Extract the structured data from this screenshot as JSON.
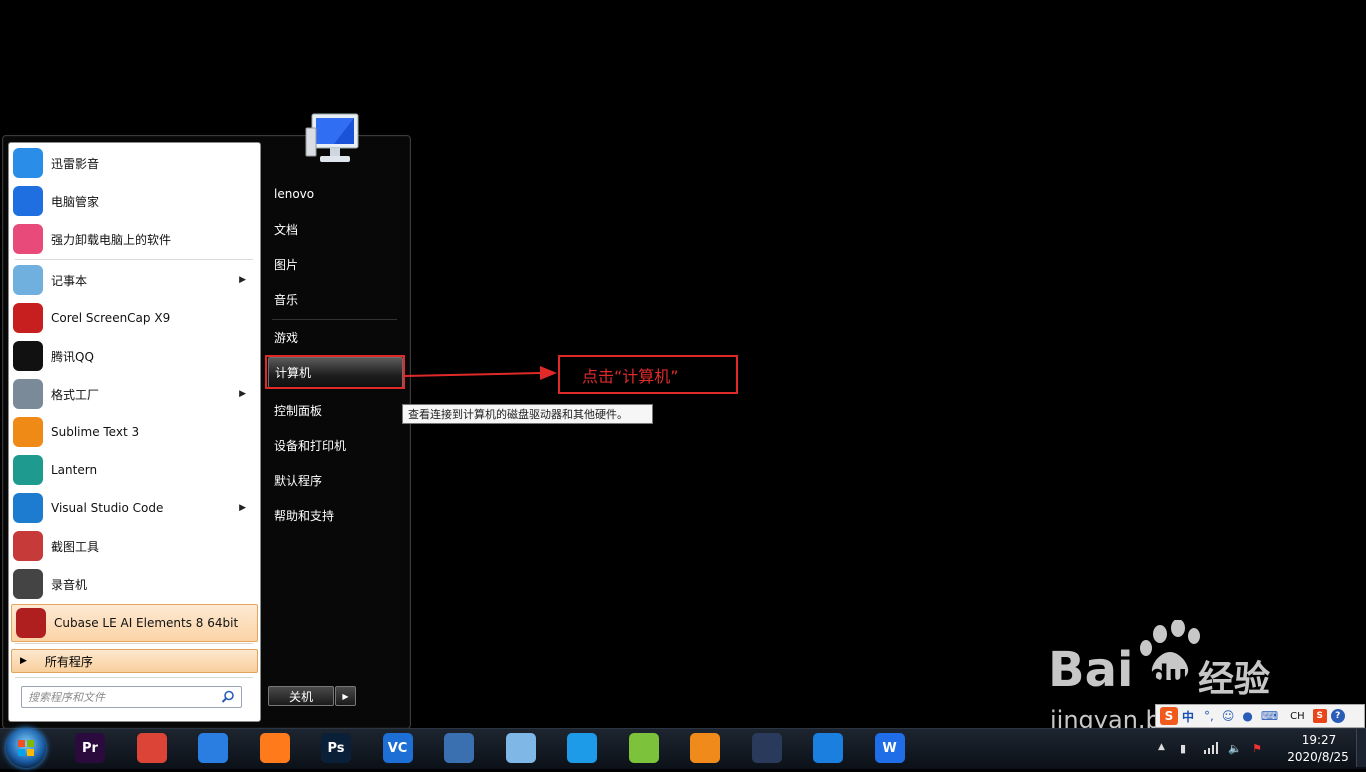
{
  "pinned": [
    {
      "label": "迅雷影音",
      "icon": "xunlei-player-icon",
      "color": "#2a8de8"
    },
    {
      "label": "电脑管家",
      "icon": "pc-manager-shield-icon",
      "color": "#1f6fe0"
    },
    {
      "label": "强力卸载电脑上的软件",
      "icon": "uninstaller-flower-icon",
      "color": "#e84a7a"
    }
  ],
  "recent": [
    {
      "label": "记事本",
      "icon": "notepad-icon",
      "color": "#6fb0df",
      "has_submenu": true
    },
    {
      "label": "Corel ScreenCap X9",
      "icon": "corel-screencap-icon",
      "color": "#c71f1f",
      "has_submenu": false
    },
    {
      "label": "腾讯QQ",
      "icon": "qq-penguin-icon",
      "color": "#111111",
      "has_submenu": false
    },
    {
      "label": "格式工厂",
      "icon": "format-factory-icon",
      "color": "#7a8a99",
      "has_submenu": true
    },
    {
      "label": "Sublime Text 3",
      "icon": "sublime-text-icon",
      "color": "#ef8a16",
      "has_submenu": false
    },
    {
      "label": "Lantern",
      "icon": "lantern-icon",
      "color": "#1f9a8f",
      "has_submenu": false
    },
    {
      "label": "Visual Studio Code",
      "icon": "vscode-icon",
      "color": "#1e7cd0",
      "has_submenu": true
    },
    {
      "label": "截图工具",
      "icon": "snipping-tool-scissors-icon",
      "color": "#c63a3a",
      "has_submenu": false
    },
    {
      "label": "录音机",
      "icon": "sound-recorder-mic-icon",
      "color": "#444444",
      "has_submenu": false
    },
    {
      "label": "Cubase LE AI Elements 8 64bit",
      "icon": "cubase-icon",
      "color": "#b01f1f",
      "has_submenu": false
    }
  ],
  "all_programs_label": "所有程序",
  "search_placeholder": "搜索程序和文件",
  "right_pane": {
    "user": "lenovo",
    "documents": "文档",
    "pictures": "图片",
    "music": "音乐",
    "games": "游戏",
    "computer": "计算机",
    "control_panel": "控制面板",
    "devices_printers": "设备和打印机",
    "default_programs": "默认程序",
    "help_support": "帮助和支持",
    "shutdown": "关机"
  },
  "tooltip": "查看连接到计算机的磁盘驱动器和其他硬件。",
  "annotation": "点击“计算机”",
  "taskbar": {
    "apps": [
      {
        "icon": "premiere-pro-icon",
        "color": "#2b0a3d",
        "text": "Pr"
      },
      {
        "icon": "chrome-icon",
        "color": "#db4437",
        "text": ""
      },
      {
        "icon": "sogou-icon",
        "color": "#2a7de1",
        "text": ""
      },
      {
        "icon": "firefox-icon",
        "color": "#ff7a1a",
        "text": ""
      },
      {
        "icon": "photoshop-icon",
        "color": "#0a1f38",
        "text": "Ps"
      },
      {
        "icon": "vc-icon",
        "color": "#1d6fd6",
        "text": "VC"
      },
      {
        "icon": "network-tool-icon",
        "color": "#3a6fb0",
        "text": ""
      },
      {
        "icon": "network-search-icon",
        "color": "#7fb8e6",
        "text": ""
      },
      {
        "icon": "file-blue-icon",
        "color": "#1e9be8",
        "text": ""
      },
      {
        "icon": "cube-3d-icon",
        "color": "#7cc23a",
        "text": ""
      },
      {
        "icon": "blender-icon",
        "color": "#f08a1a",
        "text": ""
      },
      {
        "icon": "cinema4d-icon",
        "color": "#2a3a5a",
        "text": ""
      },
      {
        "icon": "grid-app-icon",
        "color": "#1b7fe0",
        "text": ""
      },
      {
        "icon": "wps-icon",
        "color": "#1f6ee8",
        "text": "W"
      }
    ],
    "clock_time": "19:27",
    "clock_date": "2020/8/25"
  },
  "ime": {
    "mode": "中",
    "lang": "CH"
  },
  "watermark": {
    "brand": "Bai",
    "du": "du",
    "cn": "经验",
    "url": "jingyan.baidu.com"
  }
}
